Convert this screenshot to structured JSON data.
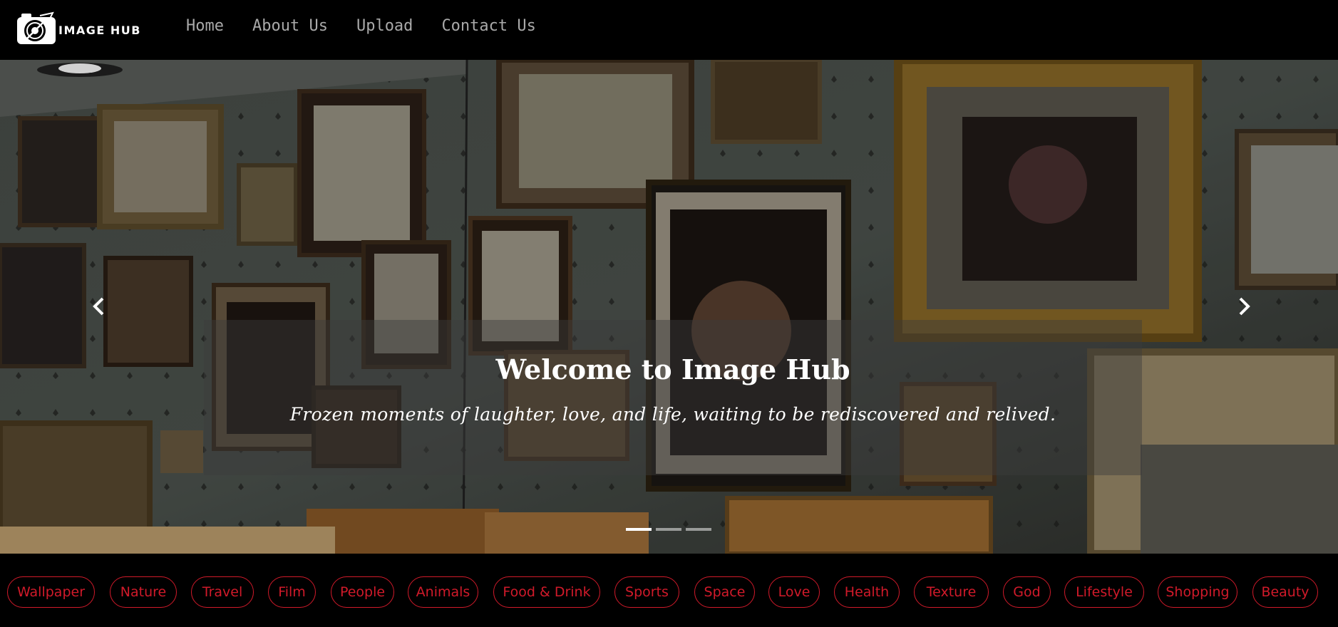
{
  "brand": {
    "logo_text": "IMAGE HUB"
  },
  "nav": {
    "links": [
      {
        "label": "Home"
      },
      {
        "label": "About Us"
      },
      {
        "label": "Upload"
      },
      {
        "label": "Contact Us"
      }
    ]
  },
  "hero": {
    "title": "Welcome to Image Hub",
    "subtitle": "Frozen moments of laughter, love, and life, waiting to be rediscovered and relived.",
    "prev_icon": "chevron-left-icon",
    "next_icon": "chevron-right-icon",
    "slide_count": 3,
    "active_slide": 1
  },
  "categories": [
    {
      "label": "Wallpaper"
    },
    {
      "label": "Nature"
    },
    {
      "label": "Travel"
    },
    {
      "label": "Film"
    },
    {
      "label": "People"
    },
    {
      "label": "Animals"
    },
    {
      "label": "Food & Drink"
    },
    {
      "label": "Sports"
    },
    {
      "label": "Space"
    },
    {
      "label": "Love"
    },
    {
      "label": "Health"
    },
    {
      "label": "Texture"
    },
    {
      "label": "God"
    },
    {
      "label": "Lifestyle"
    },
    {
      "label": "Shopping"
    },
    {
      "label": "Beauty"
    }
  ],
  "colors": {
    "accent": "#d11a2a",
    "nav_text": "#a9a9a9",
    "background": "#000000"
  }
}
